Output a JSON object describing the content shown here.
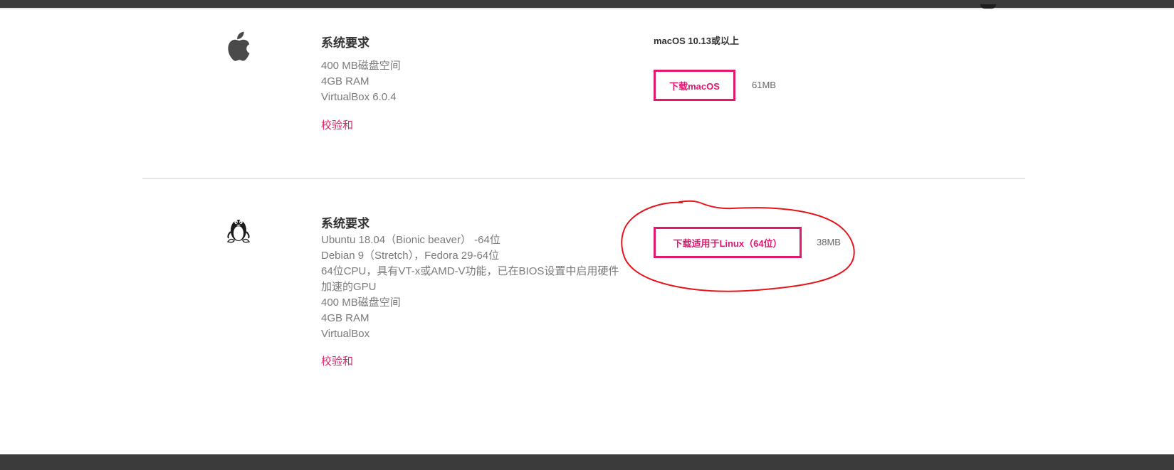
{
  "macos": {
    "logo_icon": "apple-icon",
    "heading": "系统要求",
    "requirements": [
      "400 MB磁盘空间",
      "4GB RAM",
      "VirtualBox 6.0.4"
    ],
    "checksum_label": "校验和",
    "os_version": "macOS 10.13或以上",
    "download_label": "下载macOS",
    "file_size": "61MB"
  },
  "linux": {
    "logo_icon": "tux-penguin-icon",
    "heading": "系统要求",
    "requirements": [
      "Ubuntu 18.04（Bionic beaver） -64位",
      "Debian 9（Stretch），Fedora 29-64位",
      "64位CPU，具有VT-x或AMD-V功能，已在BIOS设置中启用硬件加速的GPU",
      "400 MB磁盘空间",
      "4GB RAM",
      "VirtualBox"
    ],
    "checksum_label": "校验和",
    "download_label": "下载适用于Linux（64位）",
    "file_size": "38MB"
  },
  "colors": {
    "accent": "#e0186e",
    "annotation": "#e8141c",
    "dark_bar": "#3b3b3b"
  }
}
